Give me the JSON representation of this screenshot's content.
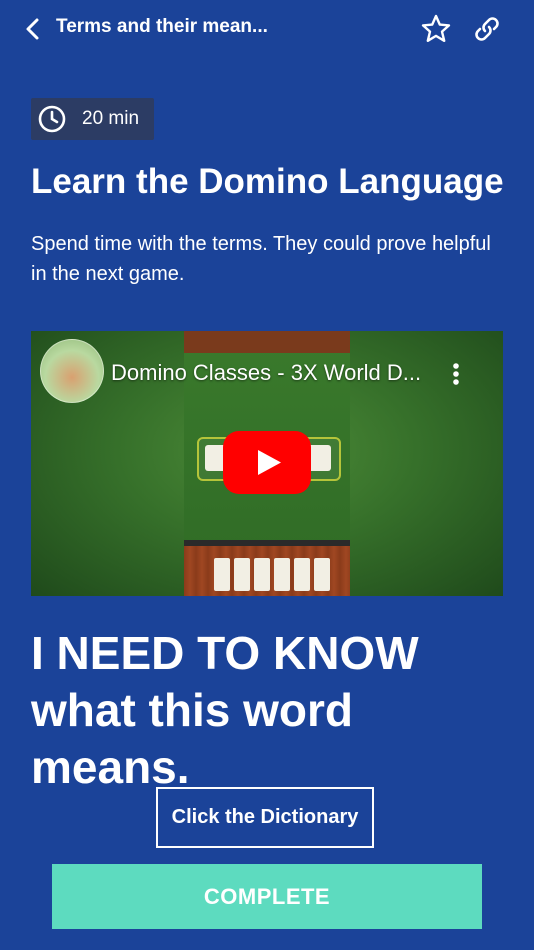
{
  "header": {
    "title": "Terms and their mean...",
    "back_icon": "chevron-left-icon",
    "star_icon": "star-outline-icon",
    "link_icon": "link-icon"
  },
  "lesson": {
    "duration": "20 min",
    "title": "Learn the Domino Language",
    "description": "Spend time with the terms.  They could prove helpful in the next game."
  },
  "video": {
    "title": "Domino Classes - 3X World D...",
    "play_icon": "youtube-play-icon",
    "menu_icon": "more-vertical-icon"
  },
  "prompt": {
    "text": "I NEED TO KNOW what this word means."
  },
  "actions": {
    "dictionary_label": "Click the Dictionary",
    "complete_label": "COMPLETE"
  },
  "colors": {
    "background": "#1b4399",
    "badge": "#2c3c64",
    "complete": "#5ddbbf",
    "youtube_red": "#ff0000"
  }
}
